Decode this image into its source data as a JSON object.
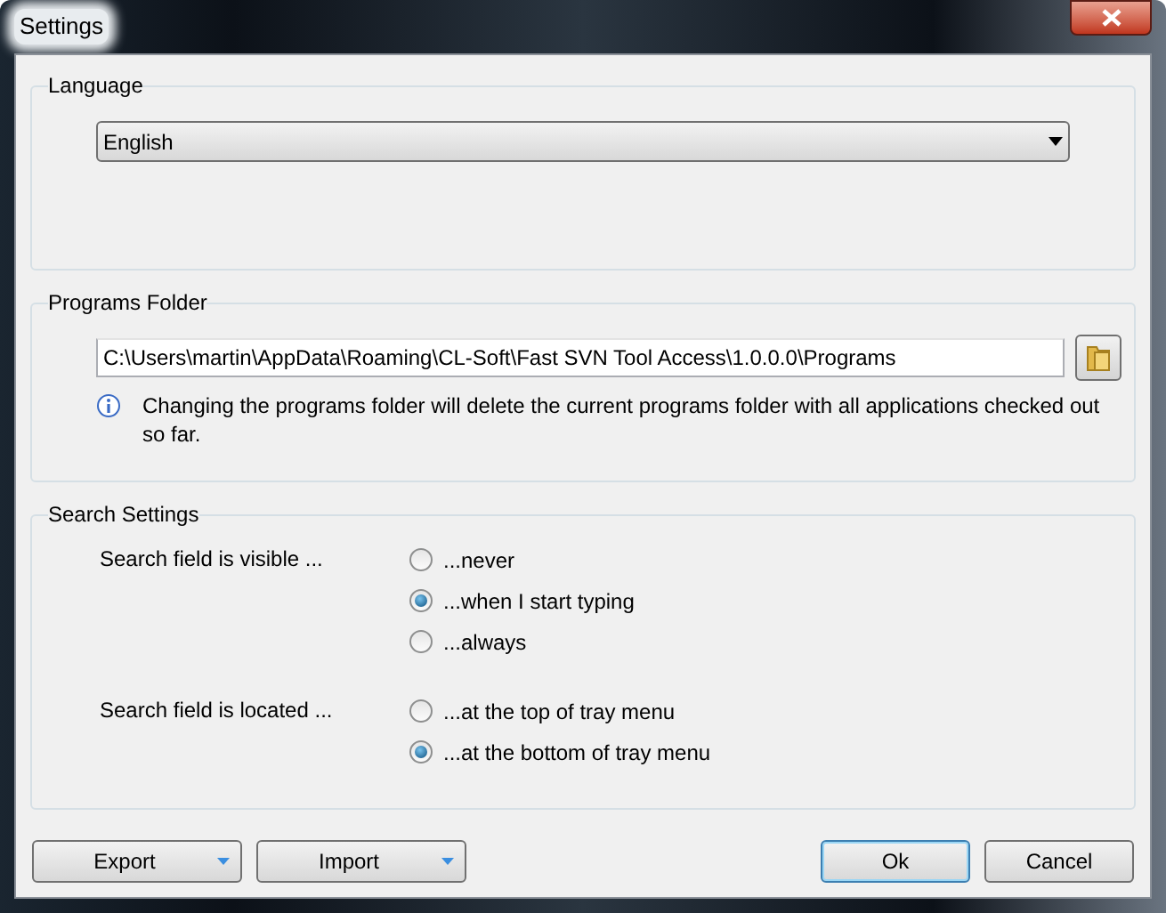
{
  "window": {
    "title": "Settings"
  },
  "language": {
    "title": "Language",
    "value": "English"
  },
  "programs_folder": {
    "title": "Programs Folder",
    "path": "C:\\Users\\martin\\AppData\\Roaming\\CL-Soft\\Fast SVN Tool Access\\1.0.0.0\\Programs",
    "info": "Changing the programs folder will delete the current programs folder with all applications checked out so far."
  },
  "search_settings": {
    "title": "Search Settings",
    "groups": [
      {
        "label": "Search field is visible ...",
        "options": [
          {
            "label": "...never",
            "selected": false
          },
          {
            "label": "...when I start typing",
            "selected": true
          },
          {
            "label": "...always",
            "selected": false
          }
        ]
      },
      {
        "label": "Search field is located ...",
        "options": [
          {
            "label": "...at the top of tray menu",
            "selected": false
          },
          {
            "label": "...at the bottom of tray menu",
            "selected": true
          }
        ]
      }
    ]
  },
  "buttons": [
    {
      "label": "Export",
      "kind": "split",
      "default": false
    },
    {
      "label": "Import",
      "kind": "split",
      "default": false
    },
    {
      "label": "Ok",
      "kind": "plain",
      "default": true
    },
    {
      "label": "Cancel",
      "kind": "plain",
      "default": false
    }
  ]
}
